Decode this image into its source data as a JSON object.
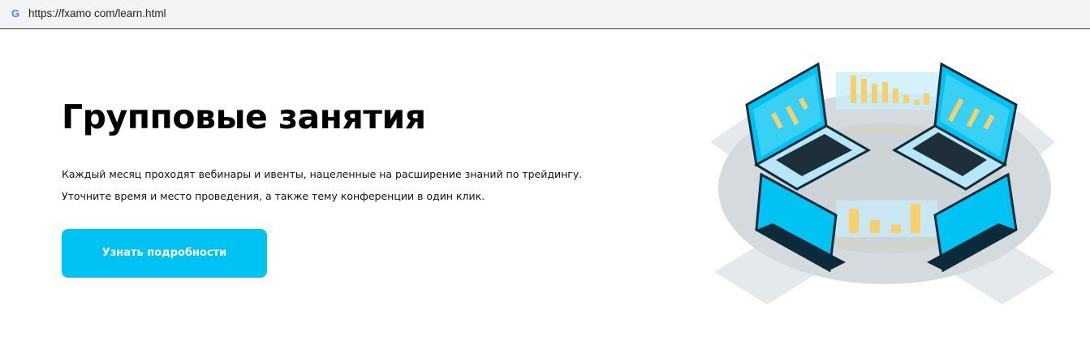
{
  "browser": {
    "url": "https://fxamo com/learn.html",
    "favicon_letter": "G"
  },
  "hero": {
    "title": "Групповые занятия",
    "description_line1": "Каждый месяц проходят вебинары и ивенты, нацеленные на расширение знаний по трейдингу.",
    "description_line2": "Уточните время и место проведения, а также тему конференции в один клик.",
    "cta_label": "Узнать подробности"
  },
  "colors": {
    "accent": "#00c2f3",
    "chart_bars": "#f7cf6b",
    "platform": "#d9dde0"
  }
}
